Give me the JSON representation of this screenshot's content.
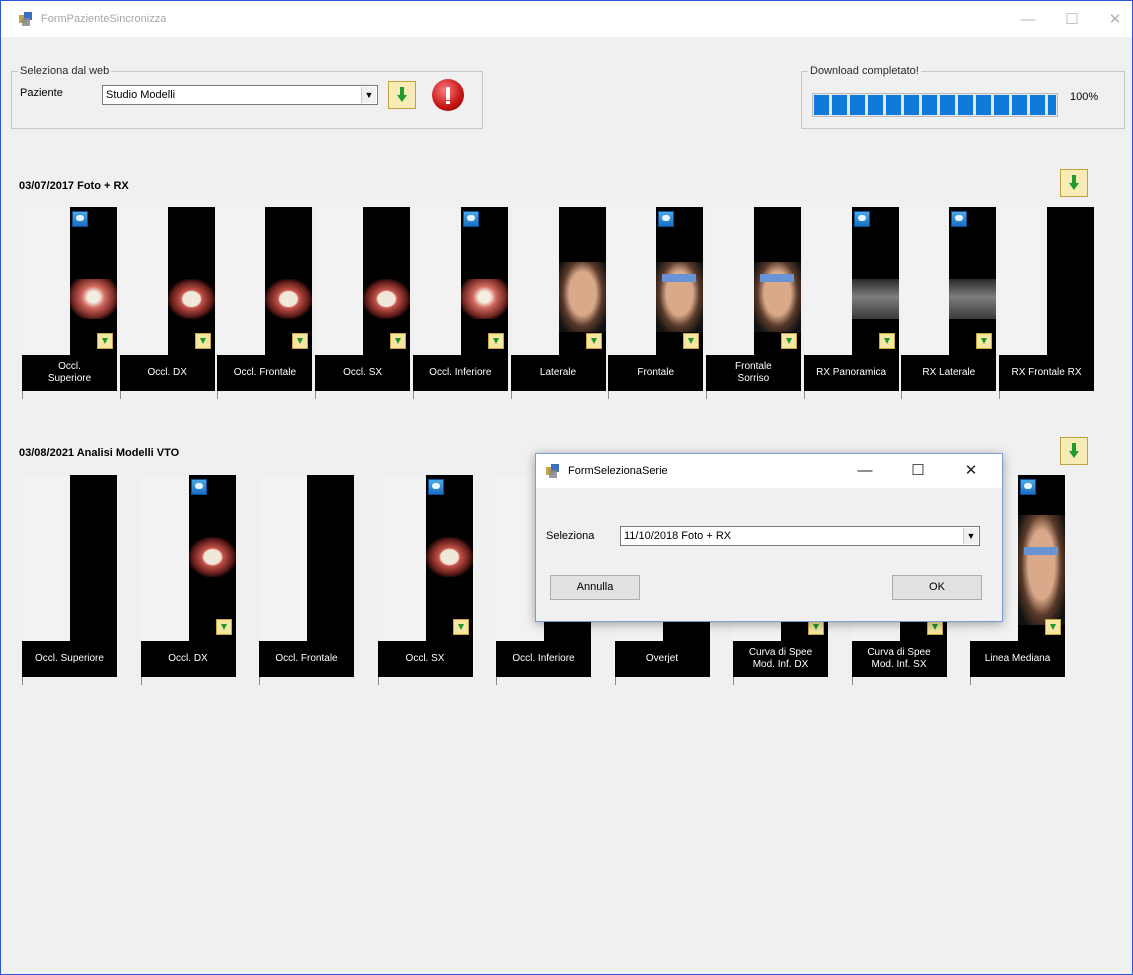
{
  "window": {
    "title": "FormPazienteSincronizza",
    "minimize_icon": "minimize-icon",
    "maximize_icon": "maximize-icon",
    "close_icon": "close-icon"
  },
  "web_selection": {
    "group_label": "Seleziona dal web",
    "patient_label": "Paziente",
    "patient_value": "Studio Modelli",
    "download_icon": "download-icon",
    "stop_icon": "stop-icon"
  },
  "download_status": {
    "group_label": "Download completato!",
    "progress_percent": 100,
    "progress_text": "100%",
    "progress_color": "#0f7ad9"
  },
  "series": [
    {
      "title": "03/07/2017 Foto + RX",
      "images": [
        {
          "label": "Occl.\nSuperiore",
          "photo": "occlusal-upper",
          "cloud": true,
          "download": true
        },
        {
          "label": "Occl. DX",
          "photo": "teeth",
          "cloud": false,
          "download": true
        },
        {
          "label": "Occl. Frontale",
          "photo": "teeth",
          "cloud": false,
          "download": true
        },
        {
          "label": "Occl. SX",
          "photo": "teeth",
          "cloud": false,
          "download": true
        },
        {
          "label": "Occl. Inferiore",
          "photo": "occlusal-lower",
          "cloud": true,
          "download": true
        },
        {
          "label": "Laterale",
          "photo": "face-profile",
          "cloud": false,
          "download": true
        },
        {
          "label": "Frontale",
          "photo": "face",
          "cloud": true,
          "download": true
        },
        {
          "label": "Frontale\nSorriso",
          "photo": "face",
          "cloud": false,
          "download": true
        },
        {
          "label": "RX Panoramica",
          "photo": "xray",
          "cloud": true,
          "download": true
        },
        {
          "label": "RX Laterale",
          "photo": "xray",
          "cloud": true,
          "download": true
        },
        {
          "label": "RX Frontale RX",
          "photo": "none",
          "cloud": false,
          "download": false
        }
      ]
    },
    {
      "title": "03/08/2021 Analisi Modelli VTO",
      "images": [
        {
          "label": "Occl. Superiore",
          "photo": "none",
          "cloud": false,
          "download": false
        },
        {
          "label": "Occl. DX",
          "photo": "teeth",
          "cloud": true,
          "download": true
        },
        {
          "label": "Occl. Frontale",
          "photo": "none",
          "cloud": false,
          "download": false
        },
        {
          "label": "Occl. SX",
          "photo": "teeth",
          "cloud": true,
          "download": true
        },
        {
          "label": "Occl. Inferiore",
          "photo": "none",
          "cloud": false,
          "download": false
        },
        {
          "label": "Overjet",
          "photo": "none",
          "cloud": false,
          "download": false
        },
        {
          "label": "Curva di Spee\nMod. Inf. DX",
          "photo": "none",
          "cloud": false,
          "download": true
        },
        {
          "label": "Curva di Spee\nMod. Inf. SX",
          "photo": "none",
          "cloud": false,
          "download": true
        },
        {
          "label": "Linea Mediana",
          "photo": "face",
          "cloud": true,
          "download": true
        }
      ]
    }
  ],
  "dialog": {
    "title": "FormSelezionaSerie",
    "select_label": "Seleziona",
    "select_value": "11/10/2018 Foto + RX",
    "cancel_label": "Annulla",
    "ok_label": "OK"
  }
}
